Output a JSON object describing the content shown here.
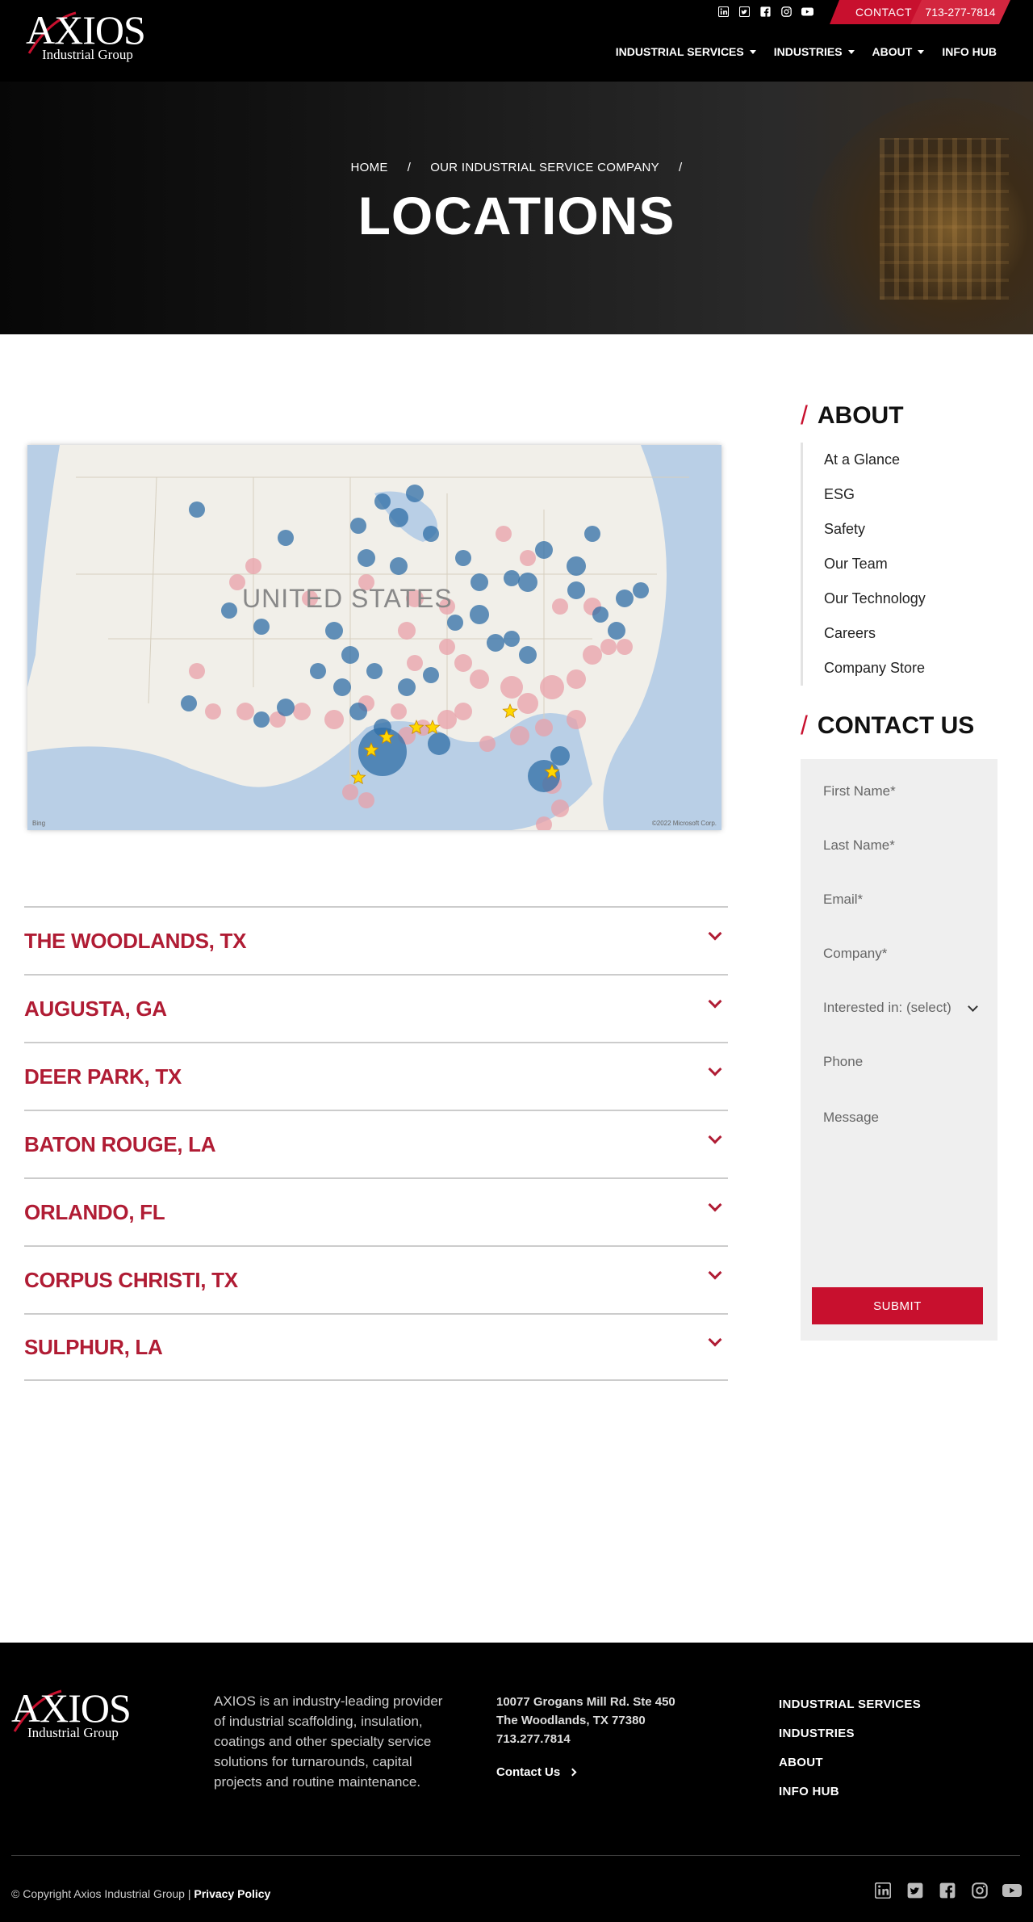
{
  "header": {
    "logo_text": "AXIOS",
    "logo_sub": "Industrial Group",
    "social_icons": [
      "linkedin-icon",
      "twitter-icon",
      "facebook-icon",
      "instagram-icon",
      "youtube-icon"
    ],
    "contact_label": "CONTACT",
    "phone": "713-277-7814",
    "nav": [
      {
        "label": "INDUSTRIAL SERVICES",
        "dropdown": true
      },
      {
        "label": "INDUSTRIES",
        "dropdown": true
      },
      {
        "label": "ABOUT",
        "dropdown": true
      },
      {
        "label": "INFO HUB",
        "dropdown": false
      }
    ]
  },
  "hero": {
    "breadcrumb": [
      "HOME",
      "/",
      "OUR INDUSTRIAL SERVICE COMPANY",
      "/"
    ],
    "title": "LOCATIONS"
  },
  "map": {
    "label": "UNITED STATES",
    "attribution_left": "Bing",
    "attribution_right": "©2022 Microsoft Corp."
  },
  "locations": [
    "THE WOODLANDS, TX",
    "AUGUSTA, GA",
    "DEER PARK, TX",
    "BATON ROUGE, LA",
    "ORLANDO, FL",
    "CORPUS CHRISTI, TX",
    "SULPHUR, LA"
  ],
  "sidebar": {
    "about_title": "ABOUT",
    "about_items": [
      "At a Glance",
      "ESG",
      "Safety",
      "Our Team",
      "Our Technology",
      "Careers",
      "Company Store"
    ],
    "contact_title": "CONTACT US",
    "form": {
      "first_name": "First Name*",
      "last_name": "Last Name*",
      "email": "Email*",
      "company": "Company*",
      "interest": "Interested in: (select)",
      "phone": "Phone",
      "message": "Message",
      "submit": "SUBMIT"
    }
  },
  "footer": {
    "description": "AXIOS is an industry-leading provider of industrial scaffolding, insulation, coatings and other specialty service solutions for turnarounds, capital projects and routine maintenance.",
    "address_line1": "10077 Grogans Mill Rd. Ste 450",
    "address_line2": "The Woodlands, TX 77380",
    "phone": "713.277.7814",
    "contact_link": "Contact Us",
    "links": [
      "INDUSTRIAL SERVICES",
      "INDUSTRIES",
      "ABOUT",
      "INFO HUB"
    ],
    "copyright": "© Copyright Axios Industrial Group |",
    "privacy": "Privacy Policy"
  },
  "colors": {
    "brand_red": "#c8102e",
    "header_bg": "#000000",
    "map_blue": "#2f6ea5",
    "map_pink": "#e8a0a8",
    "star_gold": "#ffd700"
  }
}
